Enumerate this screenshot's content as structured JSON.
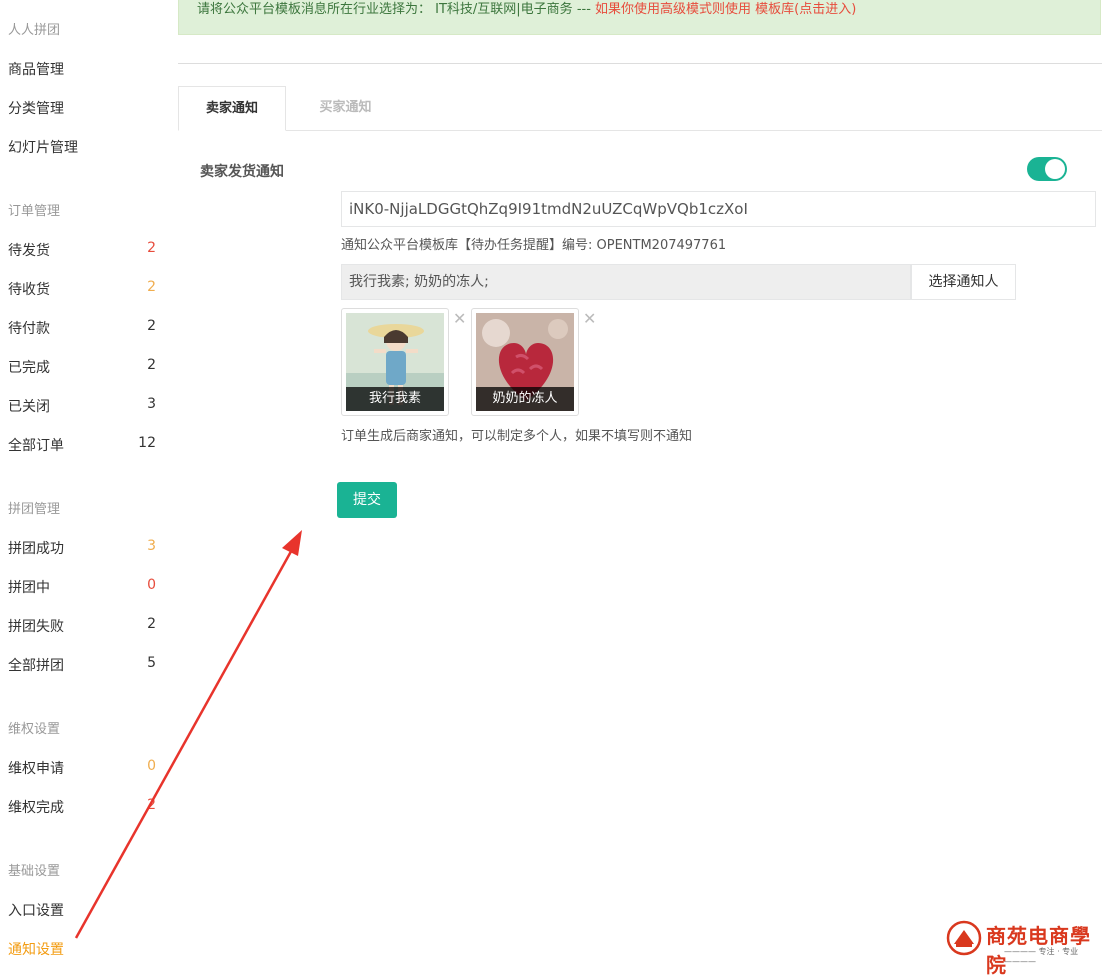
{
  "sidebar": {
    "sections": [
      {
        "title": "人人拼团",
        "items": [
          {
            "label": "商品管理",
            "count": ""
          },
          {
            "label": "分类管理",
            "count": ""
          },
          {
            "label": "幻灯片管理",
            "count": ""
          }
        ]
      },
      {
        "title": "订单管理",
        "items": [
          {
            "label": "待发货",
            "count": "2"
          },
          {
            "label": "待收货",
            "count": "2"
          },
          {
            "label": "待付款",
            "count": "2"
          },
          {
            "label": "已完成",
            "count": "2"
          },
          {
            "label": "已关闭",
            "count": "3"
          },
          {
            "label": "全部订单",
            "count": "12"
          }
        ]
      },
      {
        "title": "拼团管理",
        "items": [
          {
            "label": "拼团成功",
            "count": "3"
          },
          {
            "label": "拼团中",
            "count": "0"
          },
          {
            "label": "拼团失败",
            "count": "2"
          },
          {
            "label": "全部拼团",
            "count": "5"
          }
        ]
      },
      {
        "title": "维权设置",
        "items": [
          {
            "label": "维权申请",
            "count": "0"
          },
          {
            "label": "维权完成",
            "count": "2"
          }
        ]
      },
      {
        "title": "基础设置",
        "items": [
          {
            "label": "入口设置",
            "count": ""
          },
          {
            "label": "通知设置",
            "count": ""
          }
        ]
      }
    ]
  },
  "alert": {
    "prefix": "请将公众平台模板消息所在行业选择为：",
    "industry": " IT科技/互联网|电子商务 --- ",
    "advanced": "如果你使用高级模式则使用 ",
    "link": "模板库(点击进入)"
  },
  "tabs": {
    "seller": "卖家通知",
    "buyer": "买家通知"
  },
  "form": {
    "label": "卖家发货通知",
    "template_id": "iNK0-NjjaLDGGtQhZq9I91tmdN2uUZCqWpVQb1czXoI",
    "template_help": "通知公众平台模板库【待办任务提醒】编号: OPENTM207497761",
    "notify_value": "我行我素; 奶奶的冻人;",
    "notify_button": "选择通知人",
    "users": [
      {
        "name": "我行我素"
      },
      {
        "name": "奶奶的冻人"
      }
    ],
    "remove_glyph": "✕",
    "notify_help": "订单生成后商家通知，可以制定多个人，如果不填写则不通知",
    "submit": "提交"
  },
  "logo": {
    "text": "商苑电商學院",
    "sub": "———— 专注 · 专业 ————"
  },
  "colors": {
    "accent": "#1ab394",
    "active_nav": "#f39c12",
    "count_red": "#e74c3c",
    "count_orange": "#f0ad4e",
    "arrow": "#e8342c"
  }
}
